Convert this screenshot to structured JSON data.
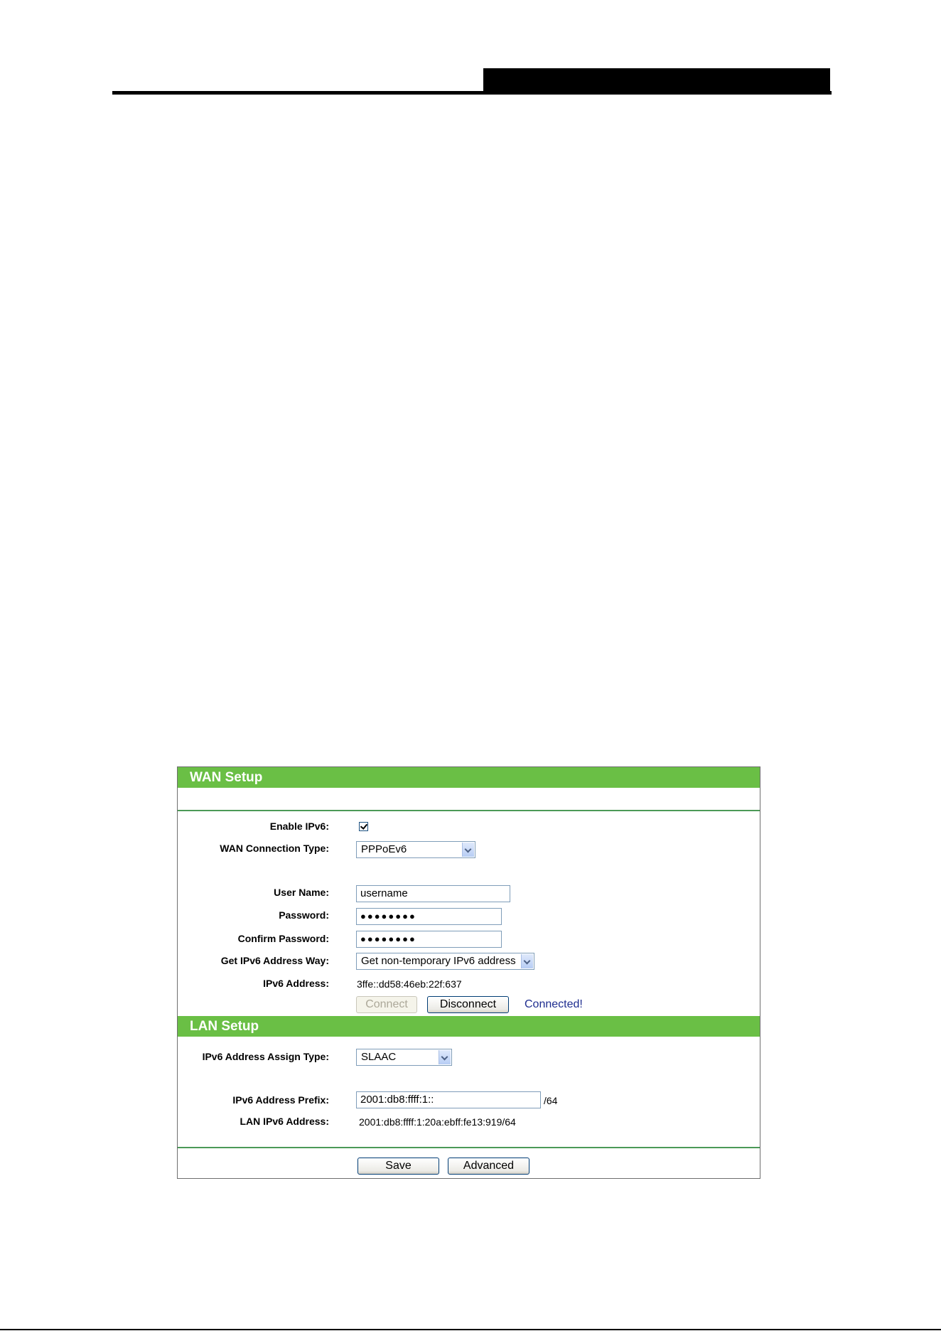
{
  "wan": {
    "title": "WAN Setup",
    "enable_ipv6_label": "Enable IPv6:",
    "enable_ipv6_checked": true,
    "connection_type_label": "WAN Connection Type:",
    "connection_type_value": "PPPoEv6",
    "username_label": "User Name:",
    "username_value": "username",
    "password_label": "Password:",
    "password_value": "●●●●●●●●",
    "confirm_password_label": "Confirm Password:",
    "confirm_password_value": "●●●●●●●●",
    "address_way_label": "Get IPv6 Address Way:",
    "address_way_value": "Get non-temporary IPv6 address",
    "ipv6_address_label": "IPv6 Address:",
    "ipv6_address_value": "3ffe::dd58:46eb:22f:637",
    "connect_label": "Connect",
    "disconnect_label": "Disconnect",
    "status_text": "Connected!"
  },
  "lan": {
    "title": "LAN Setup",
    "assign_type_label": "IPv6 Address Assign Type:",
    "assign_type_value": "SLAAC",
    "prefix_label": "IPv6 Address Prefix:",
    "prefix_value": "2001:db8:ffff:1::",
    "prefix_length": "/64",
    "lan_address_label": "LAN IPv6 Address:",
    "lan_address_value": "2001:db8:ffff:1:20a:ebff:fe13:919/64"
  },
  "actions": {
    "save_label": "Save",
    "advanced_label": "Advanced"
  },
  "colors": {
    "section_header": "#6abf45",
    "divider": "#4c9a57",
    "status": "#1e2d8f"
  }
}
